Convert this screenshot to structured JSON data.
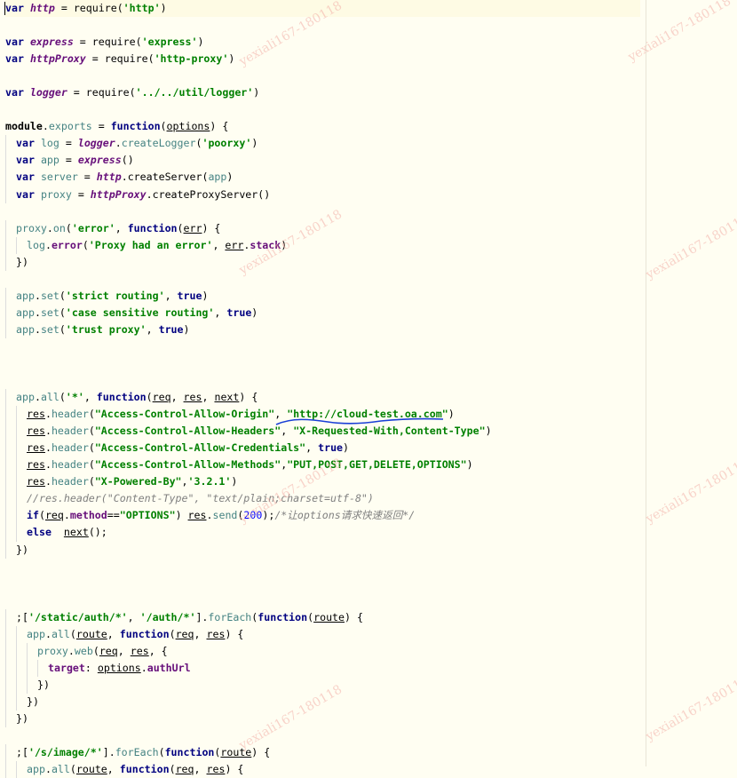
{
  "watermark": {
    "text": "yexiali167-180118",
    "color": "#f3b0a8"
  },
  "editor": {
    "background": "#fffef2",
    "colors": {
      "keyword": "#000080",
      "string": "#008000",
      "global_var": "#660e7a",
      "local_var": "#458383",
      "comment": "#808080",
      "number": "#0000ff"
    },
    "lines": [
      {
        "tokens": [
          [
            "kw",
            "var"
          ],
          [
            "punc",
            " "
          ],
          [
            "gv",
            "http"
          ],
          [
            "punc",
            " = "
          ],
          [
            "punc",
            "require"
          ],
          [
            "punc",
            "("
          ],
          [
            "str",
            "'http'"
          ],
          [
            "punc",
            ")"
          ]
        ]
      },
      {
        "tokens": []
      },
      {
        "tokens": [
          [
            "kw",
            "var"
          ],
          [
            "punc",
            " "
          ],
          [
            "gv",
            "express"
          ],
          [
            "punc",
            " = "
          ],
          [
            "punc",
            "require"
          ],
          [
            "punc",
            "("
          ],
          [
            "str",
            "'express'"
          ],
          [
            "punc",
            ")"
          ]
        ]
      },
      {
        "tokens": [
          [
            "kw",
            "var"
          ],
          [
            "punc",
            " "
          ],
          [
            "gv",
            "httpProxy"
          ],
          [
            "punc",
            " = "
          ],
          [
            "punc",
            "require"
          ],
          [
            "punc",
            "("
          ],
          [
            "str",
            "'http-proxy'"
          ],
          [
            "punc",
            ")"
          ]
        ]
      },
      {
        "tokens": []
      },
      {
        "tokens": [
          [
            "kw",
            "var"
          ],
          [
            "punc",
            " "
          ],
          [
            "gv",
            "logger"
          ],
          [
            "punc",
            " = "
          ],
          [
            "punc",
            "require"
          ],
          [
            "punc",
            "("
          ],
          [
            "str",
            "'../../util/logger'"
          ],
          [
            "punc",
            ")"
          ]
        ]
      },
      {
        "tokens": []
      },
      {
        "tokens": [
          [
            "kn",
            "module"
          ],
          [
            "punc",
            "."
          ],
          [
            "fn",
            "exports"
          ],
          [
            "punc",
            " = "
          ],
          [
            "kw",
            "function"
          ],
          [
            "punc",
            "("
          ],
          [
            "prm",
            "options"
          ],
          [
            "punc",
            ") {"
          ]
        ]
      },
      {
        "indent": 1,
        "tokens": [
          [
            "kw",
            "var"
          ],
          [
            "punc",
            " "
          ],
          [
            "lv",
            "log"
          ],
          [
            "punc",
            " = "
          ],
          [
            "gv",
            "logger"
          ],
          [
            "punc",
            "."
          ],
          [
            "fn",
            "createLogger"
          ],
          [
            "punc",
            "("
          ],
          [
            "str",
            "'poorxy'"
          ],
          [
            "punc",
            ")"
          ]
        ]
      },
      {
        "indent": 1,
        "tokens": [
          [
            "kw",
            "var"
          ],
          [
            "punc",
            " "
          ],
          [
            "lv",
            "app"
          ],
          [
            "punc",
            " = "
          ],
          [
            "gv",
            "express"
          ],
          [
            "punc",
            "()"
          ]
        ]
      },
      {
        "indent": 1,
        "tokens": [
          [
            "kw",
            "var"
          ],
          [
            "punc",
            " "
          ],
          [
            "lv",
            "server"
          ],
          [
            "punc",
            " = "
          ],
          [
            "gv",
            "http"
          ],
          [
            "punc",
            "."
          ],
          [
            "punc",
            "createServer"
          ],
          [
            "punc",
            "("
          ],
          [
            "lv",
            "app"
          ],
          [
            "punc",
            ")"
          ]
        ]
      },
      {
        "indent": 1,
        "tokens": [
          [
            "kw",
            "var"
          ],
          [
            "punc",
            " "
          ],
          [
            "lv",
            "proxy"
          ],
          [
            "punc",
            " = "
          ],
          [
            "gv",
            "httpProxy"
          ],
          [
            "punc",
            "."
          ],
          [
            "punc",
            "createProxyServer"
          ],
          [
            "punc",
            "()"
          ]
        ]
      },
      {
        "tokens": []
      },
      {
        "indent": 1,
        "tokens": [
          [
            "lv",
            "proxy"
          ],
          [
            "punc",
            "."
          ],
          [
            "fn",
            "on"
          ],
          [
            "punc",
            "("
          ],
          [
            "str",
            "'error'"
          ],
          [
            "punc",
            ", "
          ],
          [
            "kw",
            "function"
          ],
          [
            "punc",
            "("
          ],
          [
            "prm",
            "err"
          ],
          [
            "punc",
            ") {"
          ]
        ]
      },
      {
        "indent": 2,
        "tokens": [
          [
            "lv",
            "log"
          ],
          [
            "punc",
            "."
          ],
          [
            "prop",
            "error"
          ],
          [
            "punc",
            "("
          ],
          [
            "str",
            "'Proxy had an error'"
          ],
          [
            "punc",
            ", "
          ],
          [
            "prm",
            "err"
          ],
          [
            "punc",
            "."
          ],
          [
            "prop",
            "stack"
          ],
          [
            "punc",
            ")"
          ]
        ]
      },
      {
        "indent": 1,
        "tokens": [
          [
            "punc",
            "})"
          ]
        ]
      },
      {
        "tokens": []
      },
      {
        "indent": 1,
        "tokens": [
          [
            "lv",
            "app"
          ],
          [
            "punc",
            "."
          ],
          [
            "fn",
            "set"
          ],
          [
            "punc",
            "("
          ],
          [
            "str",
            "'strict routing'"
          ],
          [
            "punc",
            ", "
          ],
          [
            "kw",
            "true"
          ],
          [
            "punc",
            ")"
          ]
        ]
      },
      {
        "indent": 1,
        "tokens": [
          [
            "lv",
            "app"
          ],
          [
            "punc",
            "."
          ],
          [
            "fn",
            "set"
          ],
          [
            "punc",
            "("
          ],
          [
            "str",
            "'case sensitive routing'"
          ],
          [
            "punc",
            ", "
          ],
          [
            "kw",
            "true"
          ],
          [
            "punc",
            ")"
          ]
        ]
      },
      {
        "indent": 1,
        "tokens": [
          [
            "lv",
            "app"
          ],
          [
            "punc",
            "."
          ],
          [
            "fn",
            "set"
          ],
          [
            "punc",
            "("
          ],
          [
            "str",
            "'trust proxy'"
          ],
          [
            "punc",
            ", "
          ],
          [
            "kw",
            "true"
          ],
          [
            "punc",
            ")"
          ]
        ]
      },
      {
        "tokens": []
      },
      {
        "tokens": []
      },
      {
        "tokens": []
      },
      {
        "indent": 1,
        "tokens": [
          [
            "lv",
            "app"
          ],
          [
            "punc",
            "."
          ],
          [
            "fn",
            "all"
          ],
          [
            "punc",
            "("
          ],
          [
            "str",
            "'*'"
          ],
          [
            "punc",
            ", "
          ],
          [
            "kw",
            "function"
          ],
          [
            "punc",
            "("
          ],
          [
            "prm",
            "req"
          ],
          [
            "punc",
            ", "
          ],
          [
            "prm",
            "res"
          ],
          [
            "punc",
            ", "
          ],
          [
            "prm",
            "next"
          ],
          [
            "punc",
            ") {"
          ]
        ]
      },
      {
        "indent": 2,
        "tokens": [
          [
            "prm",
            "res"
          ],
          [
            "punc",
            "."
          ],
          [
            "fn",
            "header"
          ],
          [
            "punc",
            "("
          ],
          [
            "str",
            "\"Access-Control-Allow-Origin\""
          ],
          [
            "punc",
            ", "
          ],
          [
            "str",
            "\"http://cloud-test.oa.com\""
          ],
          [
            "punc",
            ")"
          ]
        ]
      },
      {
        "indent": 2,
        "tokens": [
          [
            "prm",
            "res"
          ],
          [
            "punc",
            "."
          ],
          [
            "fn",
            "header"
          ],
          [
            "punc",
            "("
          ],
          [
            "str",
            "\"Access-Control-Allow-Headers\""
          ],
          [
            "punc",
            ", "
          ],
          [
            "str",
            "\"X-Requested-With,Content-Type\""
          ],
          [
            "punc",
            ")"
          ]
        ]
      },
      {
        "indent": 2,
        "tokens": [
          [
            "prm",
            "res"
          ],
          [
            "punc",
            "."
          ],
          [
            "fn",
            "header"
          ],
          [
            "punc",
            "("
          ],
          [
            "str",
            "\"Access-Control-Allow-Credentials\""
          ],
          [
            "punc",
            ", "
          ],
          [
            "kw",
            "true"
          ],
          [
            "punc",
            ")"
          ]
        ]
      },
      {
        "indent": 2,
        "tokens": [
          [
            "prm",
            "res"
          ],
          [
            "punc",
            "."
          ],
          [
            "fn",
            "header"
          ],
          [
            "punc",
            "("
          ],
          [
            "str",
            "\"Access-Control-Allow-Methods\""
          ],
          [
            "punc",
            ","
          ],
          [
            "str",
            "\"PUT,POST,GET,DELETE,OPTIONS\""
          ],
          [
            "punc",
            ")"
          ]
        ]
      },
      {
        "indent": 2,
        "tokens": [
          [
            "prm",
            "res"
          ],
          [
            "punc",
            "."
          ],
          [
            "fn",
            "header"
          ],
          [
            "punc",
            "("
          ],
          [
            "str",
            "\"X-Powered-By\""
          ],
          [
            "punc",
            ","
          ],
          [
            "str",
            "'3.2.1'"
          ],
          [
            "punc",
            ")"
          ]
        ]
      },
      {
        "indent": 2,
        "tokens": [
          [
            "cmt",
            "//res.header(\"Content-Type\", \"text/plain;charset=utf-8\")"
          ]
        ]
      },
      {
        "indent": 2,
        "tokens": [
          [
            "kw",
            "if"
          ],
          [
            "punc",
            "("
          ],
          [
            "prm",
            "req"
          ],
          [
            "punc",
            "."
          ],
          [
            "prop",
            "method"
          ],
          [
            "punc",
            "=="
          ],
          [
            "str",
            "\"OPTIONS\""
          ],
          [
            "punc",
            ") "
          ],
          [
            "prm",
            "res"
          ],
          [
            "punc",
            "."
          ],
          [
            "fn",
            "send"
          ],
          [
            "punc",
            "("
          ],
          [
            "num",
            "200"
          ],
          [
            "punc",
            ");"
          ],
          [
            "cmt",
            "/*让options请求快速返回*/"
          ]
        ]
      },
      {
        "indent": 2,
        "tokens": [
          [
            "kw",
            "else"
          ],
          [
            "punc",
            "  "
          ],
          [
            "prm",
            "next"
          ],
          [
            "punc",
            "();"
          ]
        ]
      },
      {
        "indent": 1,
        "tokens": [
          [
            "punc",
            "})"
          ]
        ]
      },
      {
        "tokens": []
      },
      {
        "tokens": []
      },
      {
        "tokens": []
      },
      {
        "indent": 1,
        "tokens": [
          [
            "punc",
            ";["
          ],
          [
            "str",
            "'/static/auth/*'"
          ],
          [
            "punc",
            ", "
          ],
          [
            "str",
            "'/auth/*'"
          ],
          [
            "punc",
            "]."
          ],
          [
            "fn",
            "forEach"
          ],
          [
            "punc",
            "("
          ],
          [
            "kw",
            "function"
          ],
          [
            "punc",
            "("
          ],
          [
            "prm",
            "route"
          ],
          [
            "punc",
            ") {"
          ]
        ]
      },
      {
        "indent": 2,
        "tokens": [
          [
            "lv",
            "app"
          ],
          [
            "punc",
            "."
          ],
          [
            "fn",
            "all"
          ],
          [
            "punc",
            "("
          ],
          [
            "prm",
            "route"
          ],
          [
            "punc",
            ", "
          ],
          [
            "kw",
            "function"
          ],
          [
            "punc",
            "("
          ],
          [
            "prm",
            "req"
          ],
          [
            "punc",
            ", "
          ],
          [
            "prm",
            "res"
          ],
          [
            "punc",
            ") {"
          ]
        ]
      },
      {
        "indent": 3,
        "tokens": [
          [
            "lv",
            "proxy"
          ],
          [
            "punc",
            "."
          ],
          [
            "fn",
            "web"
          ],
          [
            "punc",
            "("
          ],
          [
            "prm",
            "req"
          ],
          [
            "punc",
            ", "
          ],
          [
            "prm",
            "res"
          ],
          [
            "punc",
            ", {"
          ]
        ]
      },
      {
        "indent": 4,
        "tokens": [
          [
            "prop",
            "target"
          ],
          [
            "punc",
            ": "
          ],
          [
            "prm",
            "options"
          ],
          [
            "punc",
            "."
          ],
          [
            "prop",
            "authUrl"
          ]
        ]
      },
      {
        "indent": 3,
        "tokens": [
          [
            "punc",
            "})"
          ]
        ]
      },
      {
        "indent": 2,
        "tokens": [
          [
            "punc",
            "})"
          ]
        ]
      },
      {
        "indent": 1,
        "tokens": [
          [
            "punc",
            "})"
          ]
        ]
      },
      {
        "tokens": []
      },
      {
        "indent": 1,
        "tokens": [
          [
            "punc",
            ";["
          ],
          [
            "str",
            "'/s/image/*'"
          ],
          [
            "punc",
            "]."
          ],
          [
            "fn",
            "forEach"
          ],
          [
            "punc",
            "("
          ],
          [
            "kw",
            "function"
          ],
          [
            "punc",
            "("
          ],
          [
            "prm",
            "route"
          ],
          [
            "punc",
            ") {"
          ]
        ]
      },
      {
        "indent": 2,
        "tokens": [
          [
            "lv",
            "app"
          ],
          [
            "punc",
            "."
          ],
          [
            "fn",
            "all"
          ],
          [
            "punc",
            "("
          ],
          [
            "prm",
            "route"
          ],
          [
            "punc",
            ", "
          ],
          [
            "kw",
            "function"
          ],
          [
            "punc",
            "("
          ],
          [
            "prm",
            "req"
          ],
          [
            "punc",
            ", "
          ],
          [
            "prm",
            "res"
          ],
          [
            "punc",
            ") {"
          ]
        ]
      }
    ]
  }
}
